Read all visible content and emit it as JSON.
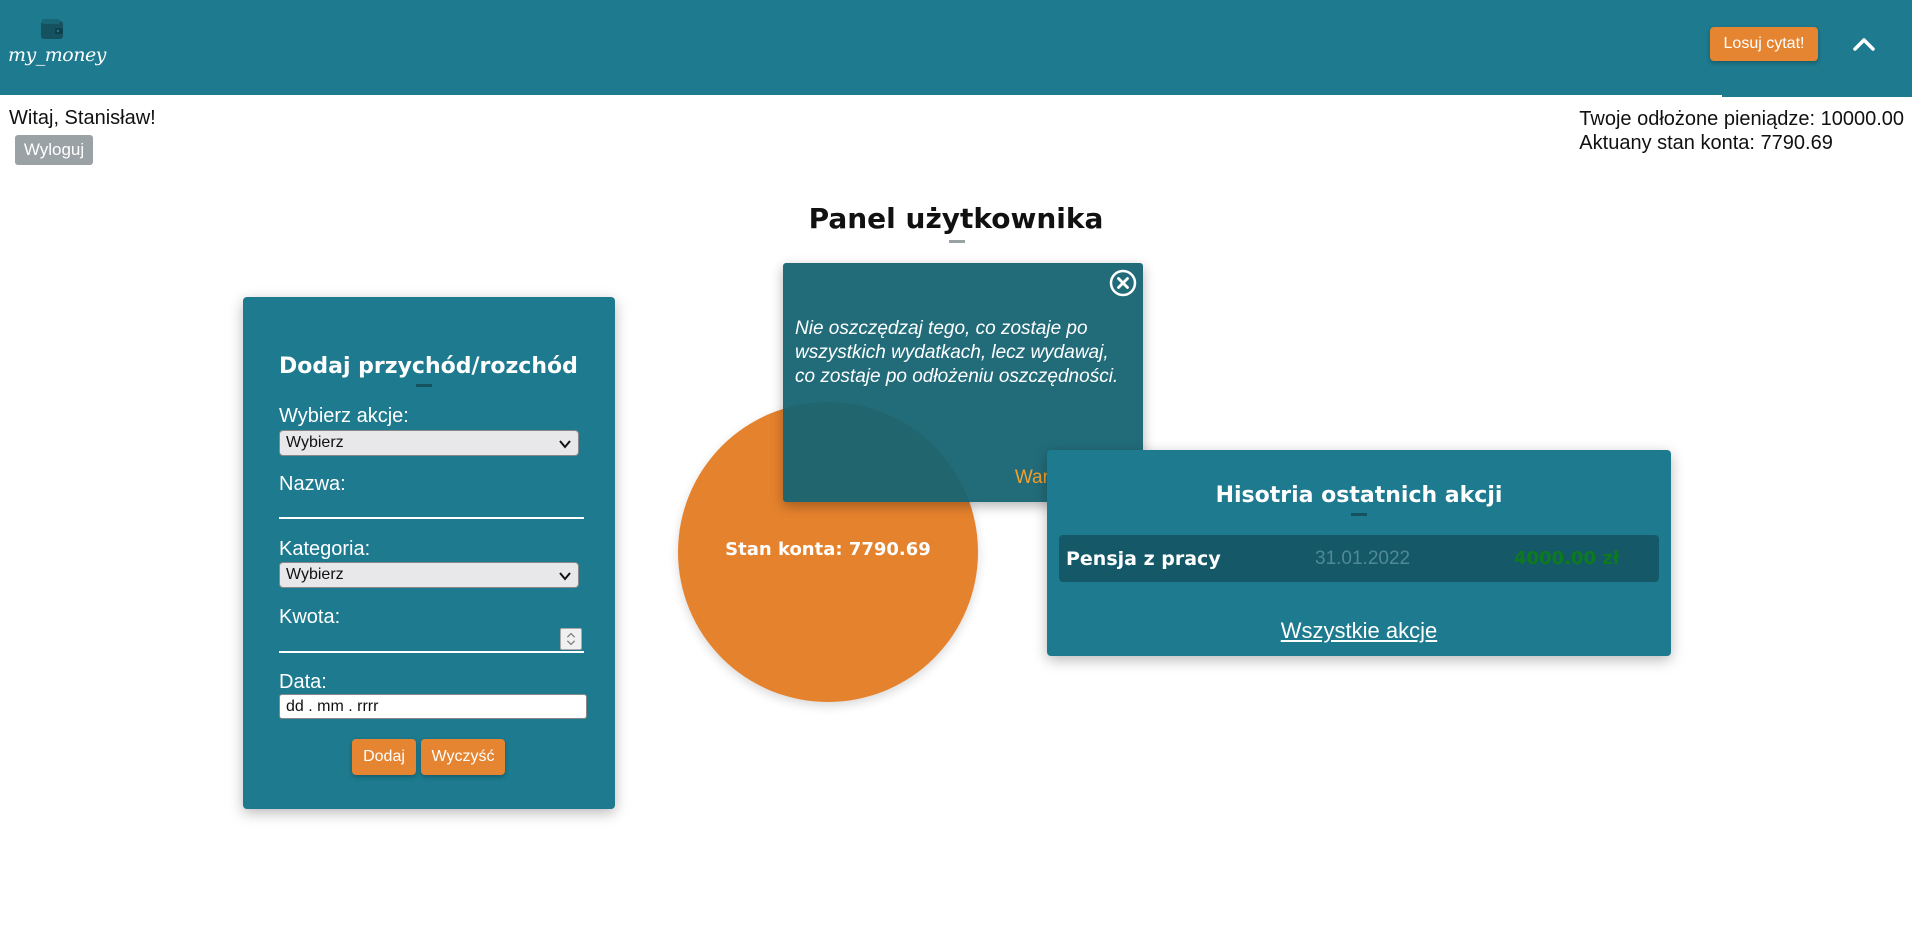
{
  "header": {
    "logo_text": "my_money",
    "logo_icon": "wallet-icon",
    "quote_button": "Losuj cytat!",
    "collapse_icon": "chevron-up-icon",
    "bar_color": "#1e7a8e",
    "accent_color": "#e58431"
  },
  "user": {
    "greeting": "Witaj, Stanisław!",
    "logout": "Wyloguj",
    "savings": "Twoje odłożone pieniądze: 10000.00",
    "balance_line": "Aktuany stan konta: 7790.69"
  },
  "panel": {
    "title": "Panel użytkownika"
  },
  "form": {
    "title": "Dodaj przychód/rozchód",
    "action_label": "Wybierz akcje:",
    "action_selected": "Wybierz",
    "name_label": "Nazwa:",
    "name_value": "",
    "category_label": "Kategoria:",
    "category_selected": "Wybierz",
    "amount_label": "Kwota:",
    "amount_value": "",
    "date_label": "Data:",
    "date_placeholder": "dd . mm . rrrr",
    "add_button": "Dodaj",
    "clear_button": "Wyczyść"
  },
  "balance": {
    "text": "Stan konta: 7790.69"
  },
  "quote": {
    "text": "Nie oszczędzaj tego, co zostaje po wszystkich wydatkach, lecz wydawaj, co zostaje po odłożeniu oszczędności.",
    "author": "Warren Buffet",
    "close_icon": "close-icon"
  },
  "history": {
    "title": "Hisotria ostatnich akcji",
    "rows": [
      {
        "name": "Pensja z pracy",
        "date": "31.01.2022",
        "amount": "4000.00 zł"
      }
    ],
    "all_link": "Wszystkie akcje"
  }
}
